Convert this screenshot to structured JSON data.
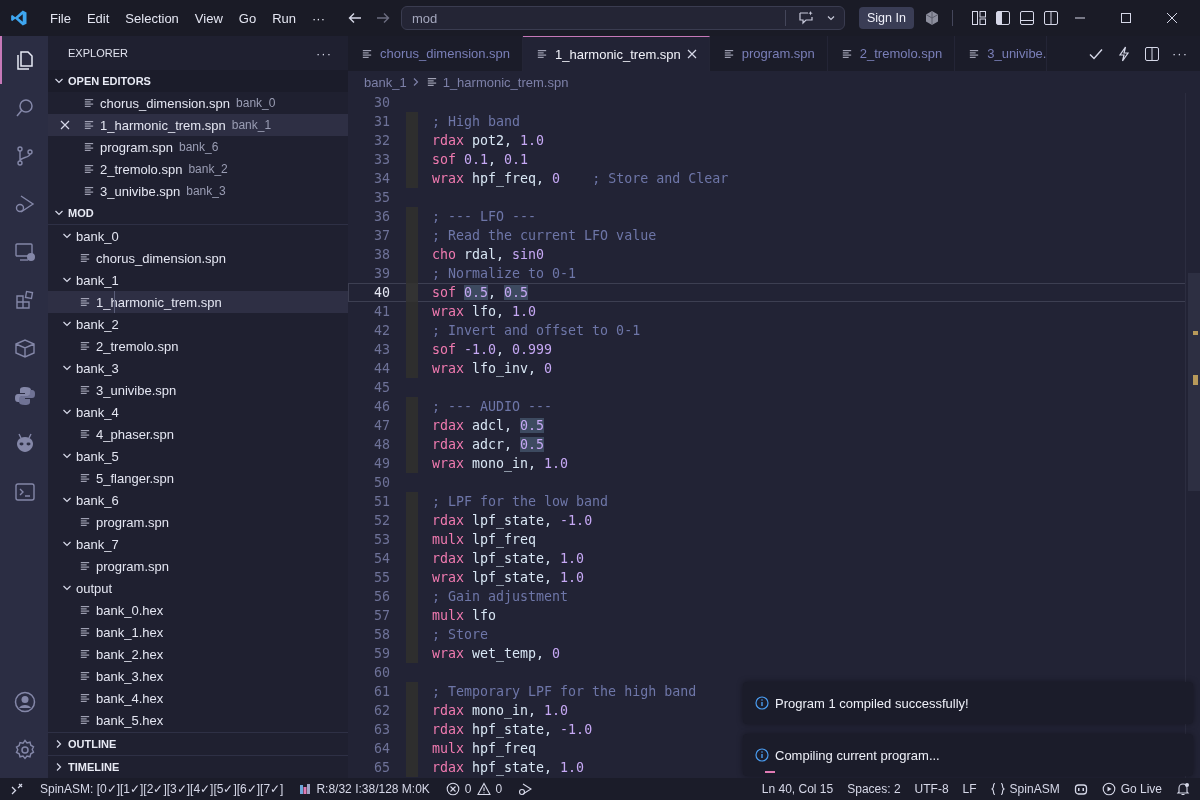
{
  "menu": [
    "File",
    "Edit",
    "Selection",
    "View",
    "Go",
    "Run",
    "···"
  ],
  "search": {
    "value": "mod"
  },
  "sign_in": "Sign In",
  "tabs": [
    {
      "label": "chorus_dimension.spn",
      "selected": false
    },
    {
      "label": "1_harmonic_trem.spn",
      "selected": true
    },
    {
      "label": "program.spn",
      "selected": false
    },
    {
      "label": "2_tremolo.spn",
      "selected": false
    },
    {
      "label": "3_univibe.",
      "selected": false
    }
  ],
  "tab_more": "···",
  "breadcrumbs": [
    "bank_1",
    "1_harmonic_trem.spn"
  ],
  "sidebar": {
    "title": "EXPLORER",
    "more": "···",
    "open_editors": {
      "title": "OPEN EDITORS",
      "expanded": true,
      "items": [
        {
          "name": "chorus_dimension.spn",
          "folder": "bank_0",
          "selected": false
        },
        {
          "name": "1_harmonic_trem.spn",
          "folder": "bank_1",
          "selected": true
        },
        {
          "name": "program.spn",
          "folder": "bank_6",
          "selected": false
        },
        {
          "name": "2_tremolo.spn",
          "folder": "bank_2",
          "selected": false
        },
        {
          "name": "3_univibe.spn",
          "folder": "bank_3",
          "selected": false
        }
      ]
    },
    "folder": {
      "title": "MOD",
      "expanded": true,
      "children": [
        {
          "name": "bank_0",
          "kind": "folder",
          "expanded": true,
          "selected": false,
          "children": [
            {
              "name": "chorus_dimension.spn",
              "kind": "file",
              "selected": false
            }
          ]
        },
        {
          "name": "bank_1",
          "kind": "folder",
          "expanded": true,
          "selected": false,
          "children": [
            {
              "name": "1_harmonic_trem.spn",
              "kind": "file",
              "selected": true
            }
          ]
        },
        {
          "name": "bank_2",
          "kind": "folder",
          "expanded": true,
          "selected": false,
          "children": [
            {
              "name": "2_tremolo.spn",
              "kind": "file",
              "selected": false
            }
          ]
        },
        {
          "name": "bank_3",
          "kind": "folder",
          "expanded": true,
          "selected": false,
          "children": [
            {
              "name": "3_univibe.spn",
              "kind": "file",
              "selected": false
            }
          ]
        },
        {
          "name": "bank_4",
          "kind": "folder",
          "expanded": true,
          "selected": false,
          "children": [
            {
              "name": "4_phaser.spn",
              "kind": "file",
              "selected": false
            }
          ]
        },
        {
          "name": "bank_5",
          "kind": "folder",
          "expanded": true,
          "selected": false,
          "children": [
            {
              "name": "5_flanger.spn",
              "kind": "file",
              "selected": false
            }
          ]
        },
        {
          "name": "bank_6",
          "kind": "folder",
          "expanded": true,
          "selected": false,
          "children": [
            {
              "name": "program.spn",
              "kind": "file",
              "selected": false
            }
          ]
        },
        {
          "name": "bank_7",
          "kind": "folder",
          "expanded": true,
          "selected": false,
          "children": [
            {
              "name": "program.spn",
              "kind": "file",
              "selected": false
            }
          ]
        },
        {
          "name": "output",
          "kind": "folder",
          "expanded": true,
          "selected": false,
          "children": [
            {
              "name": "bank_0.hex",
              "kind": "file",
              "selected": false
            },
            {
              "name": "bank_1.hex",
              "kind": "file",
              "selected": false
            },
            {
              "name": "bank_2.hex",
              "kind": "file",
              "selected": false
            },
            {
              "name": "bank_3.hex",
              "kind": "file",
              "selected": false
            },
            {
              "name": "bank_4.hex",
              "kind": "file",
              "selected": false
            },
            {
              "name": "bank_5.hex",
              "kind": "file",
              "selected": false
            }
          ]
        }
      ]
    },
    "sections": [
      {
        "title": "OUTLINE",
        "expanded": false
      },
      {
        "title": "TIMELINE",
        "expanded": false
      }
    ]
  },
  "lines": [
    {
      "number": "30",
      "current": false
    },
    {
      "number": "31",
      "current": false,
      "tokens": [
        {
          "text": "; High band",
          "kind": "com"
        }
      ]
    },
    {
      "number": "32",
      "current": false,
      "tokens": [
        {
          "text": "rdax",
          "kind": "kw"
        },
        {
          "text": " pot2, ",
          "kind": "id"
        },
        {
          "text": "1.0",
          "kind": "num"
        }
      ]
    },
    {
      "number": "33",
      "current": false,
      "tokens": [
        {
          "text": "sof ",
          "kind": "kw"
        },
        {
          "text": "0.1",
          "kind": "num"
        },
        {
          "text": ", ",
          "kind": "id"
        },
        {
          "text": "0.1",
          "kind": "num"
        }
      ]
    },
    {
      "number": "34",
      "current": false,
      "tokens": [
        {
          "text": "wrax",
          "kind": "kw"
        },
        {
          "text": " hpf_freq, ",
          "kind": "id"
        },
        {
          "text": "0",
          "kind": "num"
        },
        {
          "text": "    ; Store and Clear",
          "kind": "com"
        }
      ]
    },
    {
      "number": "35",
      "current": false
    },
    {
      "number": "36",
      "current": false,
      "tokens": [
        {
          "text": "; --- LFO ---",
          "kind": "com"
        }
      ]
    },
    {
      "number": "37",
      "current": false,
      "tokens": [
        {
          "text": "; Read the current LFO value",
          "kind": "com"
        }
      ]
    },
    {
      "number": "38",
      "current": false,
      "tokens": [
        {
          "text": "cho",
          "kind": "kw"
        },
        {
          "text": " rdal, ",
          "kind": "id"
        },
        {
          "text": "sin0",
          "kind": "num"
        }
      ]
    },
    {
      "number": "39",
      "current": false,
      "tokens": [
        {
          "text": "; Normalize to 0-1",
          "kind": "com"
        }
      ]
    },
    {
      "number": "40",
      "current": true,
      "tokens": [
        {
          "text": "sof ",
          "kind": "kw"
        },
        {
          "text": "0.5",
          "kind": "match"
        },
        {
          "text": ", ",
          "kind": "id"
        },
        {
          "text": "0.5",
          "kind": "match"
        }
      ]
    },
    {
      "number": "41",
      "current": false,
      "tokens": [
        {
          "text": "wrax",
          "kind": "kw"
        },
        {
          "text": " lfo, ",
          "kind": "id"
        },
        {
          "text": "1.0",
          "kind": "num"
        }
      ]
    },
    {
      "number": "42",
      "current": false,
      "tokens": [
        {
          "text": "; Invert and offset to 0-1",
          "kind": "com"
        }
      ]
    },
    {
      "number": "43",
      "current": false,
      "tokens": [
        {
          "text": "sof ",
          "kind": "kw"
        },
        {
          "text": "-1.0",
          "kind": "num"
        },
        {
          "text": ", ",
          "kind": "id"
        },
        {
          "text": "0.999",
          "kind": "num"
        }
      ]
    },
    {
      "number": "44",
      "current": false,
      "tokens": [
        {
          "text": "wrax",
          "kind": "kw"
        },
        {
          "text": " lfo_inv, ",
          "kind": "id"
        },
        {
          "text": "0",
          "kind": "num"
        }
      ]
    },
    {
      "number": "45",
      "current": false
    },
    {
      "number": "46",
      "current": false,
      "tokens": [
        {
          "text": "; --- AUDIO ---",
          "kind": "com"
        }
      ]
    },
    {
      "number": "47",
      "current": false,
      "tokens": [
        {
          "text": "rdax",
          "kind": "kw"
        },
        {
          "text": " adcl, ",
          "kind": "id"
        },
        {
          "text": "0.5",
          "kind": "match"
        }
      ]
    },
    {
      "number": "48",
      "current": false,
      "tokens": [
        {
          "text": "rdax",
          "kind": "kw"
        },
        {
          "text": " adcr, ",
          "kind": "id"
        },
        {
          "text": "0.5",
          "kind": "match"
        }
      ]
    },
    {
      "number": "49",
      "current": false,
      "tokens": [
        {
          "text": "wrax",
          "kind": "kw"
        },
        {
          "text": " mono_in, ",
          "kind": "id"
        },
        {
          "text": "1.0",
          "kind": "num"
        }
      ]
    },
    {
      "number": "50",
      "current": false
    },
    {
      "number": "51",
      "current": false,
      "tokens": [
        {
          "text": "; LPF for the low band",
          "kind": "com"
        }
      ]
    },
    {
      "number": "52",
      "current": false,
      "tokens": [
        {
          "text": "rdax",
          "kind": "kw"
        },
        {
          "text": " lpf_state, ",
          "kind": "id"
        },
        {
          "text": "-1.0",
          "kind": "num"
        }
      ]
    },
    {
      "number": "53",
      "current": false,
      "tokens": [
        {
          "text": "mulx",
          "kind": "kw"
        },
        {
          "text": " lpf_freq",
          "kind": "id"
        }
      ]
    },
    {
      "number": "54",
      "current": false,
      "tokens": [
        {
          "text": "rdax",
          "kind": "kw"
        },
        {
          "text": " lpf_state, ",
          "kind": "id"
        },
        {
          "text": "1.0",
          "kind": "num"
        }
      ]
    },
    {
      "number": "55",
      "current": false,
      "tokens": [
        {
          "text": "wrax",
          "kind": "kw"
        },
        {
          "text": " lpf_state, ",
          "kind": "id"
        },
        {
          "text": "1.0",
          "kind": "num"
        }
      ]
    },
    {
      "number": "56",
      "current": false,
      "tokens": [
        {
          "text": "; Gain adjustment",
          "kind": "com"
        }
      ]
    },
    {
      "number": "57",
      "current": false,
      "tokens": [
        {
          "text": "mulx",
          "kind": "kw"
        },
        {
          "text": " lfo",
          "kind": "id"
        }
      ]
    },
    {
      "number": "58",
      "current": false,
      "tokens": [
        {
          "text": "; Store",
          "kind": "com"
        }
      ]
    },
    {
      "number": "59",
      "current": false,
      "tokens": [
        {
          "text": "wrax",
          "kind": "kw"
        },
        {
          "text": " wet_temp, ",
          "kind": "id"
        },
        {
          "text": "0",
          "kind": "num"
        }
      ]
    },
    {
      "number": "60",
      "current": false
    },
    {
      "number": "61",
      "current": false,
      "tokens": [
        {
          "text": "; Temporary LPF for the high band",
          "kind": "com"
        }
      ]
    },
    {
      "number": "62",
      "current": false,
      "tokens": [
        {
          "text": "rdax",
          "kind": "kw"
        },
        {
          "text": " mono_in, ",
          "kind": "id"
        },
        {
          "text": "1.0",
          "kind": "num"
        }
      ]
    },
    {
      "number": "63",
      "current": false,
      "tokens": [
        {
          "text": "rdax",
          "kind": "kw"
        },
        {
          "text": " hpf_state, ",
          "kind": "id"
        },
        {
          "text": "-1.0",
          "kind": "num"
        }
      ]
    },
    {
      "number": "64",
      "current": false,
      "tokens": [
        {
          "text": "mulx",
          "kind": "kw"
        },
        {
          "text": " hpf_freq",
          "kind": "id"
        }
      ]
    },
    {
      "number": "65",
      "current": false,
      "tokens": [
        {
          "text": "rdax",
          "kind": "kw"
        },
        {
          "text": " hpf_state, ",
          "kind": "id"
        },
        {
          "text": "1.0",
          "kind": "num"
        }
      ]
    }
  ],
  "notifications": [
    {
      "text": "Program 1 compiled successfully!",
      "in_progress": false
    },
    {
      "text": "Compiling current program...",
      "in_progress": true
    }
  ],
  "status_bar": {
    "build": "SpinASM: [0✓][1✓][2✓][3✓][4✓][5✓][6✓][7✓]",
    "resources": "R:8/32 I:38/128 M:0K",
    "errors": "0",
    "warnings": "0",
    "position": "Ln 40, Col 15",
    "indent": "Spaces: 2",
    "encoding": "UTF-8",
    "eol": "LF",
    "language": "SpinASM",
    "go_live": "Go Live"
  }
}
